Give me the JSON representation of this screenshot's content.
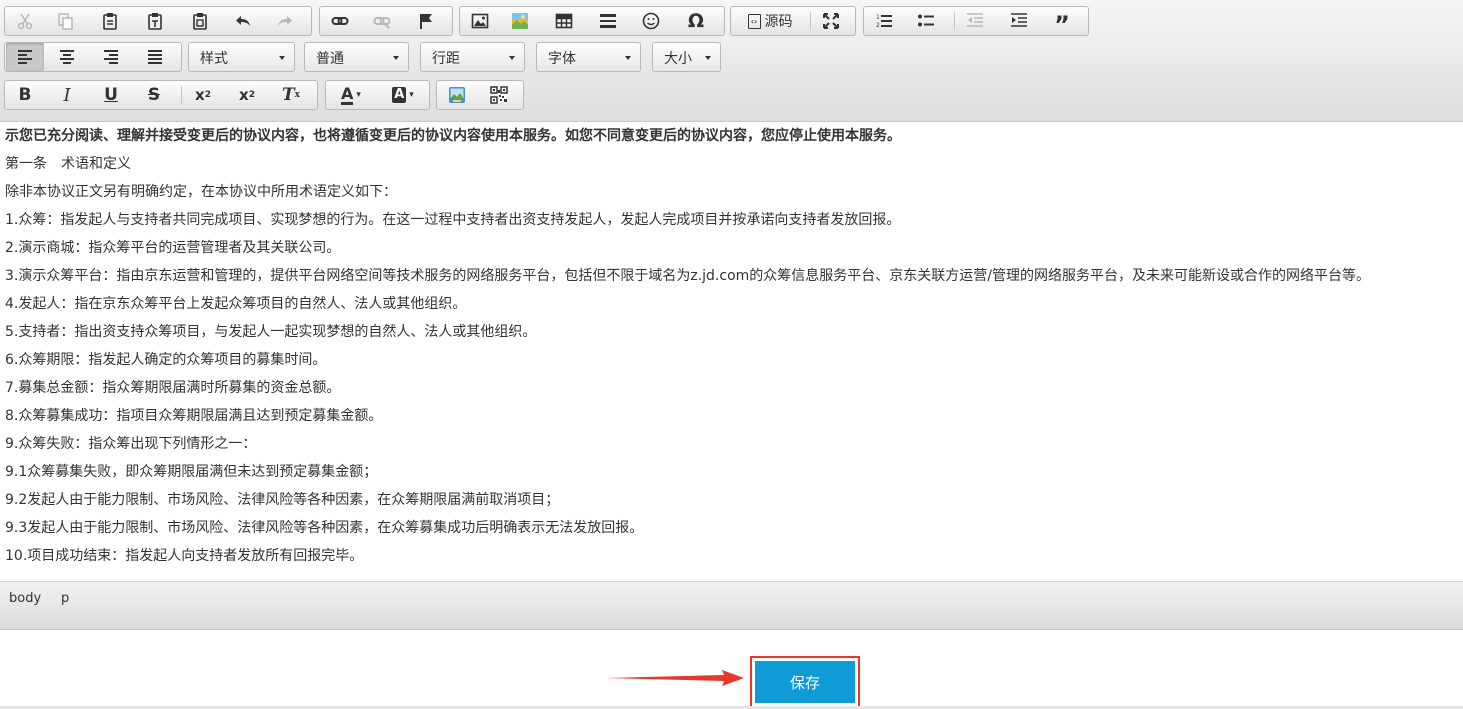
{
  "toolbar": {
    "source_label": "源码",
    "combos": {
      "style": "样式",
      "format": "普通",
      "line_height": "行距",
      "font": "字体",
      "size": "大小"
    }
  },
  "content": {
    "paragraphs": [
      "示您已充分阅读、理解并接受变更后的协议内容，也将遵循变更后的协议内容使用本服务。如您不同意变更后的协议内容，您应停止使用本服务。",
      "第一条　术语和定义",
      "除非本协议正文另有明确约定，在本协议中所用术语定义如下：",
      "1.众筹：指发起人与支持者共同完成项目、实现梦想的行为。在这一过程中支持者出资支持发起人，发起人完成项目并按承诺向支持者发放回报。",
      "2.演示商城：指众筹平台的运营管理者及其关联公司。",
      "3.演示众筹平台：指由京东运营和管理的，提供平台网络空间等技术服务的网络服务平台，包括但不限于域名为z.jd.com的众筹信息服务平台、京东关联方运营/管理的网络服务平台，及未来可能新设或合作的网络平台等。",
      "4.发起人：指在京东众筹平台上发起众筹项目的自然人、法人或其他组织。",
      "5.支持者：指出资支持众筹项目，与发起人一起实现梦想的自然人、法人或其他组织。",
      "6.众筹期限：指发起人确定的众筹项目的募集时间。",
      "7.募集总金额：指众筹期限届满时所募集的资金总额。",
      "8.众筹募集成功：指项目众筹期限届满且达到预定募集金额。",
      "9.众筹失败：指众筹出现下列情形之一：",
      "9.1众筹募集失败，即众筹期限届满但未达到预定募集金额；",
      "9.2发起人由于能力限制、市场风险、法律风险等各种因素，在众筹期限届满前取消项目；",
      "9.3发起人由于能力限制、市场风险、法律风险等各种因素，在众筹募集成功后明确表示无法发放回报。",
      "10.项目成功结束：指发起人向支持者发放所有回报完毕。"
    ]
  },
  "pathbar": {
    "items": [
      "body",
      "p"
    ]
  },
  "save": {
    "label": "保存",
    "button_color": "#109bd6",
    "highlight_color": "#e6382b"
  }
}
